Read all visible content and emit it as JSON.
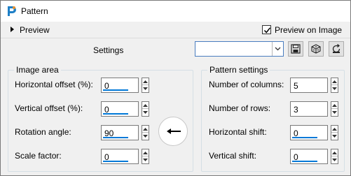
{
  "window": {
    "title": "Pattern"
  },
  "preview": {
    "label": "Preview",
    "preview_on_image_label": "Preview on Image",
    "preview_on_image_checked": true
  },
  "settings": {
    "label": "Settings",
    "selected": ""
  },
  "toolbar": {
    "save_icon": "floppy-disk-icon",
    "random_icon": "dice-icon",
    "reset_icon": "reset-icon"
  },
  "image_area": {
    "title": "Image area",
    "horizontal_offset": {
      "label": "Horizontal offset (%):",
      "value": "0"
    },
    "vertical_offset": {
      "label": "Vertical offset (%):",
      "value": "0"
    },
    "rotation_angle": {
      "label": "Rotation angle:",
      "value": "90"
    },
    "scale_factor": {
      "label": "Scale factor:",
      "value": "0"
    }
  },
  "pattern_settings": {
    "title": "Pattern settings",
    "columns": {
      "label": "Number of columns:",
      "value": "5"
    },
    "rows": {
      "label": "Number of rows:",
      "value": "3"
    },
    "horizontal_shift": {
      "label": "Horizontal shift:",
      "value": "0"
    },
    "vertical_shift": {
      "label": "Vertical shift:",
      "value": "0"
    }
  },
  "colors": {
    "accent": "#0078d7",
    "app_icon": "#1e7fc6"
  }
}
